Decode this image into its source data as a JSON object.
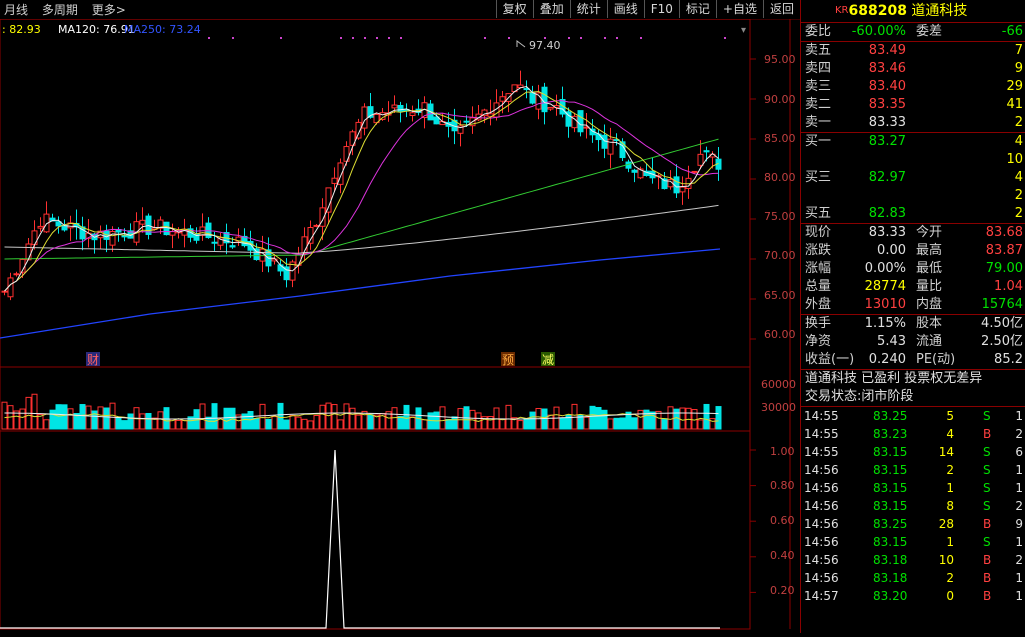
{
  "toolbar": {
    "left": [
      "月线",
      "多周期",
      "更多>"
    ],
    "right": [
      "复权",
      "叠加",
      "统计",
      "画线",
      "F10",
      "标记",
      "+自选",
      "返回"
    ]
  },
  "ma_legend": [
    {
      "text": ": 82.93",
      "color": "#ffff00"
    },
    {
      "text": "MA120: 76.91",
      "color": "#ffffff"
    },
    {
      "text": "MA250: 73.24",
      "color": "#3355ff"
    }
  ],
  "chart_data": {
    "type": "candlestick",
    "price_axis": {
      "min": 60,
      "max": 95,
      "ticks": [
        "95.00",
        "90.00",
        "85.00",
        "80.00",
        "75.00",
        "70.00",
        "65.00",
        "60.00"
      ]
    },
    "peak_label": "97.40",
    "event_tags": [
      {
        "text": "财"
      },
      {
        "text": "预"
      },
      {
        "text": "减"
      }
    ],
    "volume_axis": {
      "ticks": [
        "60000",
        "30000"
      ]
    },
    "indicator_axis": {
      "min": 0,
      "max": 1,
      "ticks": [
        "1.00",
        "0.80",
        "0.60",
        "0.40",
        "0.20"
      ]
    }
  },
  "stock": {
    "prefix": "KR",
    "code": "688208",
    "name": "道通科技"
  },
  "weibi": {
    "label1": "委比",
    "value1": "-60.00%",
    "label2": "委差",
    "value2": "-66"
  },
  "asks": [
    {
      "label": "卖五",
      "price": "83.49",
      "vol": "7"
    },
    {
      "label": "卖四",
      "price": "83.46",
      "vol": "9"
    },
    {
      "label": "卖三",
      "price": "83.40",
      "vol": "29"
    },
    {
      "label": "卖二",
      "price": "83.35",
      "vol": "41"
    },
    {
      "label": "卖一",
      "price": "83.33",
      "vol": "2"
    }
  ],
  "bids": [
    {
      "label": "买一",
      "price": "83.27",
      "vol": "4"
    },
    {
      "label": "",
      "price": "",
      "vol": "10"
    },
    {
      "label": "买三",
      "price": "82.97",
      "vol": "4"
    },
    {
      "label": "",
      "price": "",
      "vol": "2"
    },
    {
      "label": "买五",
      "price": "82.83",
      "vol": "2"
    }
  ],
  "quote": [
    {
      "l1": "现价",
      "v1": "83.33",
      "c1": "#e0e0e0",
      "l2": "今开",
      "v2": "83.68",
      "c2": "#ff4040"
    },
    {
      "l1": "涨跌",
      "v1": "0.00",
      "c1": "#e0e0e0",
      "l2": "最高",
      "v2": "83.87",
      "c2": "#ff4040"
    },
    {
      "l1": "涨幅",
      "v1": "0.00%",
      "c1": "#e0e0e0",
      "l2": "最低",
      "v2": "79.00",
      "c2": "#00e000"
    },
    {
      "l1": "总量",
      "v1": "28774",
      "c1": "#ffff00",
      "l2": "量比",
      "v2": "1.04",
      "c2": "#ff4040"
    },
    {
      "l1": "外盘",
      "v1": "13010",
      "c1": "#ff4040",
      "l2": "内盘",
      "v2": "15764",
      "c2": "#00e000"
    }
  ],
  "fund": [
    {
      "l1": "换手",
      "v1": "1.15%",
      "l2": "股本",
      "v2": "4.50亿"
    },
    {
      "l1": "净资",
      "v1": "5.43",
      "l2": "流通",
      "v2": "2.50亿"
    },
    {
      "l1": "收益(一)",
      "v1": "0.240",
      "l2": "PE(动)",
      "v2": "85.2"
    }
  ],
  "info_line": "道通科技 已盈利 投票权无差异",
  "status_line": "交易状态:闭市阶段",
  "ticks": [
    {
      "t": "14:55",
      "p": "83.25",
      "v": "5",
      "s": "S",
      "n": "1"
    },
    {
      "t": "14:55",
      "p": "83.23",
      "v": "4",
      "s": "B",
      "n": "2"
    },
    {
      "t": "14:55",
      "p": "83.15",
      "v": "14",
      "s": "S",
      "n": "6"
    },
    {
      "t": "14:56",
      "p": "83.15",
      "v": "2",
      "s": "S",
      "n": "1"
    },
    {
      "t": "14:56",
      "p": "83.15",
      "v": "1",
      "s": "S",
      "n": "1"
    },
    {
      "t": "14:56",
      "p": "83.15",
      "v": "8",
      "s": "S",
      "n": "2"
    },
    {
      "t": "14:56",
      "p": "83.25",
      "v": "28",
      "s": "B",
      "n": "9"
    },
    {
      "t": "14:56",
      "p": "83.15",
      "v": "1",
      "s": "S",
      "n": "1"
    },
    {
      "t": "14:56",
      "p": "83.18",
      "v": "10",
      "s": "B",
      "n": "2"
    },
    {
      "t": "14:56",
      "p": "83.18",
      "v": "2",
      "s": "B",
      "n": "1"
    },
    {
      "t": "14:57",
      "p": "83.20",
      "v": "0",
      "s": "B",
      "n": "1"
    }
  ]
}
